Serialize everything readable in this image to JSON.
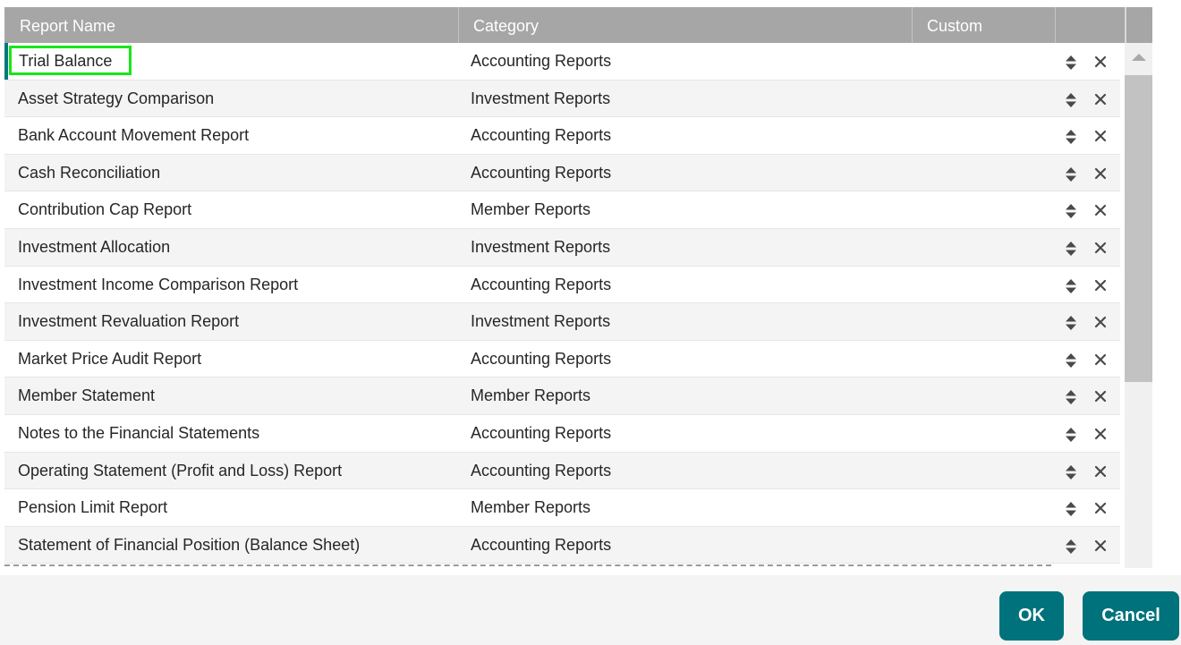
{
  "table": {
    "columns": {
      "name": "Report Name",
      "category": "Category",
      "custom": "Custom"
    },
    "rows": [
      {
        "name": "Trial Balance",
        "category": "Accounting Reports",
        "custom": ""
      },
      {
        "name": "Asset Strategy Comparison",
        "category": "Investment Reports",
        "custom": ""
      },
      {
        "name": "Bank Account Movement Report",
        "category": "Accounting Reports",
        "custom": ""
      },
      {
        "name": "Cash Reconciliation",
        "category": "Accounting Reports",
        "custom": ""
      },
      {
        "name": "Contribution Cap Report",
        "category": "Member Reports",
        "custom": ""
      },
      {
        "name": "Investment Allocation",
        "category": "Investment Reports",
        "custom": ""
      },
      {
        "name": "Investment Income Comparison Report",
        "category": "Accounting Reports",
        "custom": ""
      },
      {
        "name": "Investment Revaluation Report",
        "category": "Investment Reports",
        "custom": ""
      },
      {
        "name": "Market Price Audit Report",
        "category": "Accounting Reports",
        "custom": ""
      },
      {
        "name": "Member Statement",
        "category": "Member Reports",
        "custom": ""
      },
      {
        "name": "Notes to the Financial Statements",
        "category": "Accounting Reports",
        "custom": ""
      },
      {
        "name": "Operating Statement (Profit and Loss) Report",
        "category": "Accounting Reports",
        "custom": ""
      },
      {
        "name": "Pension Limit Report",
        "category": "Member Reports",
        "custom": ""
      },
      {
        "name": "Statement of Financial Position (Balance Sheet)",
        "category": "Accounting Reports",
        "custom": ""
      }
    ],
    "selected_row": 0,
    "row_icons": {
      "sort": "sort-up-down-icon",
      "delete": "close-x-icon"
    }
  },
  "footer": {
    "ok_label": "OK",
    "cancel_label": "Cancel"
  },
  "colors": {
    "header_bg": "#a6a6a6",
    "accent": "#00727c",
    "focus_outline": "#19e619",
    "row_alt_bg": "#f4f4f4"
  }
}
